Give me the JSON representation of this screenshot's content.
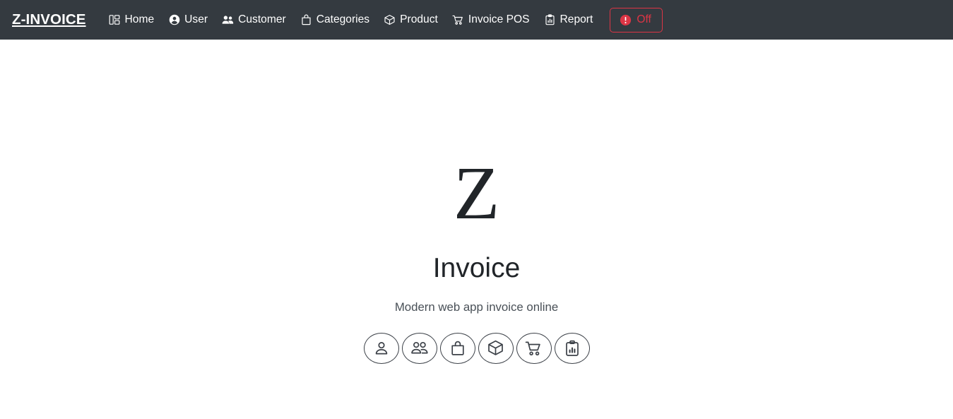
{
  "navbar": {
    "brand": "Z-INVOICE",
    "background_color": "#343a40",
    "text_color": "#ffffff",
    "items": [
      {
        "label": "Home",
        "icon": "layout-dashboard-icon"
      },
      {
        "label": "User",
        "icon": "user-circle-icon"
      },
      {
        "label": "Customer",
        "icon": "users-icon"
      },
      {
        "label": "Categories",
        "icon": "shopping-bag-icon"
      },
      {
        "label": "Product",
        "icon": "cube-icon"
      },
      {
        "label": "Invoice POS",
        "icon": "shopping-cart-icon"
      },
      {
        "label": "Report",
        "icon": "clipboard-chart-icon"
      }
    ],
    "off_button": {
      "label": "Off",
      "icon": "alert-circle-icon",
      "color": "#dc3545"
    }
  },
  "hero": {
    "logo_letter": "Z",
    "title": "Invoice",
    "subtitle": "Modern web app invoice online",
    "title_color": "#212529",
    "subtitle_color": "#495057",
    "feature_icons": [
      {
        "name": "user-icon"
      },
      {
        "name": "users-icon"
      },
      {
        "name": "shopping-bag-icon"
      },
      {
        "name": "cube-icon"
      },
      {
        "name": "shopping-cart-icon"
      },
      {
        "name": "clipboard-chart-icon"
      }
    ]
  }
}
